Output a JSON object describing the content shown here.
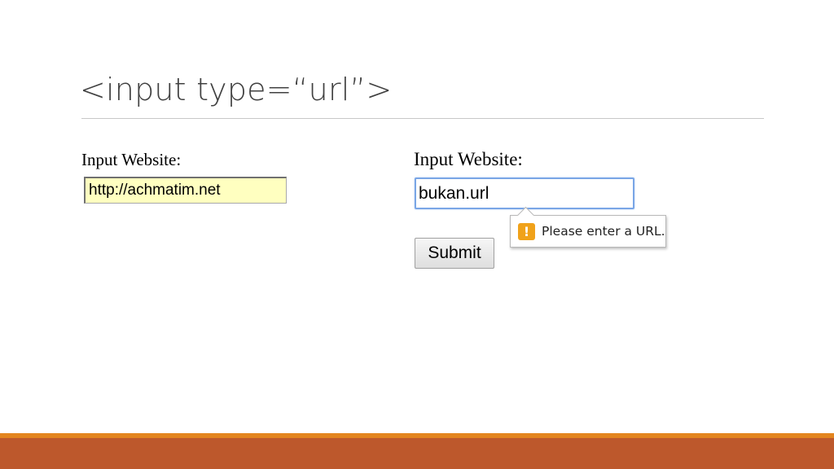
{
  "slide": {
    "title": "<input type=“url”>"
  },
  "left_demo": {
    "label": "Input Website:",
    "input_value": "http://achmatim.net"
  },
  "right_demo": {
    "label": "Input Website:",
    "input_value": "bukan.url",
    "validation_message": "Please enter a URL.",
    "warning_glyph": "!",
    "submit_label": "Submit"
  },
  "colors": {
    "autofill_bg": "#ffffc0",
    "focus_border": "#7aa6e6",
    "warning_icon": "#f0a21a",
    "footer_accent": "#e3851f",
    "footer_band": "#bd582c"
  }
}
